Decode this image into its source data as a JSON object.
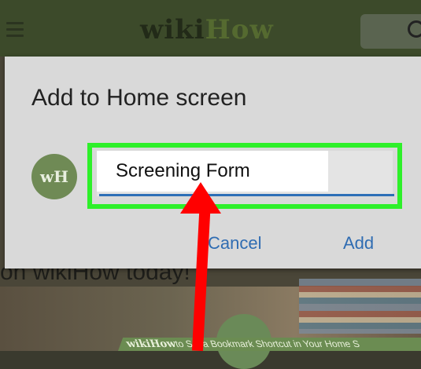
{
  "background": {
    "brand_left": "wiki",
    "brand_right": "How",
    "partial_text": "on wikiHow today!",
    "caption_brand": "wikiHow",
    "caption_text": " to Set a Bookmark Shortcut in Your Home S"
  },
  "dialog": {
    "title": "Add to Home screen",
    "icon_label": "wH",
    "name_value": "Screening Form",
    "cancel_label": "Cancel",
    "add_label": "Add"
  },
  "colors": {
    "highlight": "#2ef02a",
    "accent": "#2f6cb2",
    "arrow": "#ff0000"
  },
  "icons": [
    "hamburger-icon",
    "search-icon",
    "app-icon",
    "arrow-annotation-icon"
  ]
}
